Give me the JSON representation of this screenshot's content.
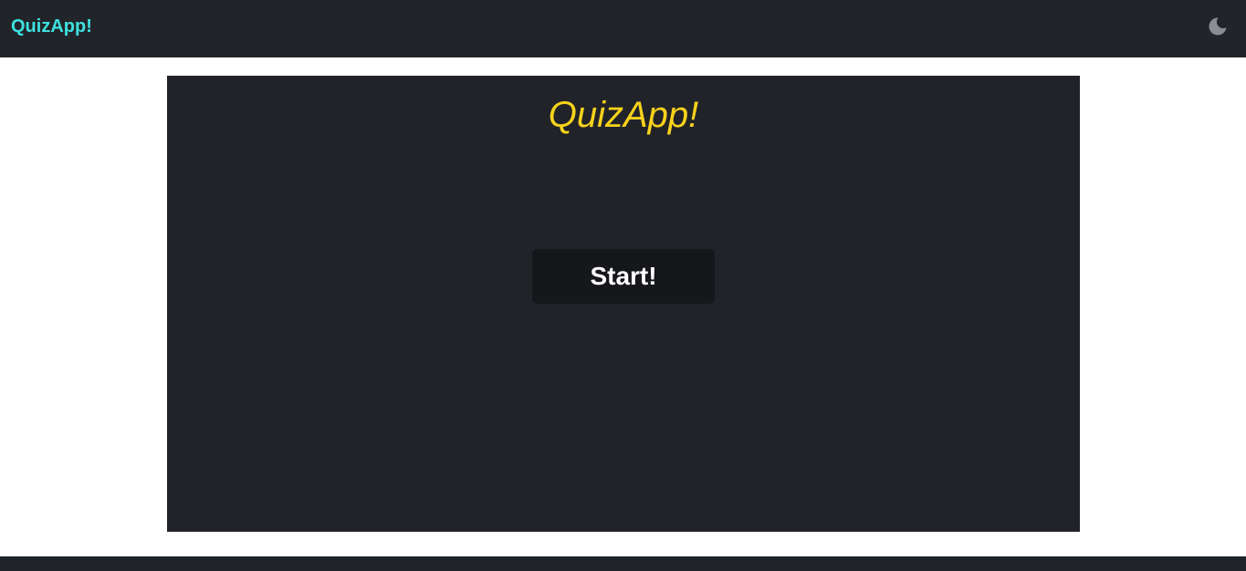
{
  "navbar": {
    "brand": "QuizApp!",
    "theme_toggle_icon": "moon-icon",
    "brand_color": "#3fe0e0",
    "background": "#212529"
  },
  "quiz": {
    "title": "QuizApp!",
    "title_color": "#f7d21b",
    "start_label": "Start!"
  }
}
